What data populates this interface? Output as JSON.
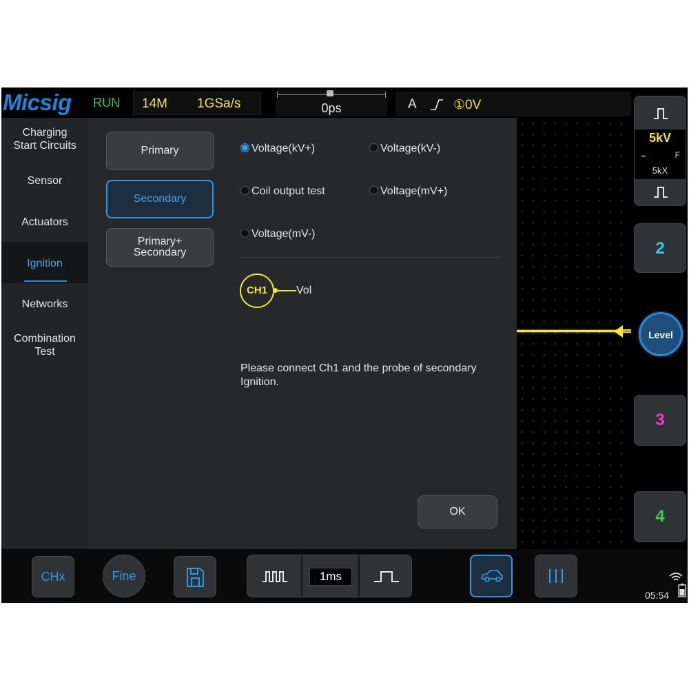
{
  "status_bar": {
    "brand": "Micsig",
    "run_state": "RUN",
    "memory_depth": "14M",
    "sample_rate": "1GSa/s",
    "horizontal_position": "0ps",
    "trigger_source": "A",
    "trigger_level": "①0V"
  },
  "left_nav": {
    "items": [
      {
        "label_line1": "Charging",
        "label_line2": "Start Circuits"
      },
      {
        "label_line1": "Sensor",
        "label_line2": ""
      },
      {
        "label_line1": "Actuators",
        "label_line2": ""
      },
      {
        "label_line1": "Ignition",
        "label_line2": ""
      },
      {
        "label_line1": "Networks",
        "label_line2": ""
      },
      {
        "label_line1": "Combination",
        "label_line2": "Test"
      }
    ],
    "active": "Ignition"
  },
  "coil_buttons": {
    "primary": "Primary",
    "secondary": "Secondary",
    "primary_secondary_line1": "Primary+",
    "primary_secondary_line2": "Secondary",
    "selected": "Secondary"
  },
  "test_options": {
    "voltage_kv_plus": "Voltage(kV+)",
    "voltage_kv_minus": "Voltage(kV-)",
    "coil_output_test": "Coil output test",
    "voltage_mv_plus": "Voltage(mV+)",
    "voltage_mv_minus": "Voltage(mV-)",
    "selected": "Voltage(kV+)"
  },
  "connection": {
    "channel": "CH1",
    "signal": "Vol",
    "message": "Please connect Ch1 and the probe of secondary Ignition."
  },
  "dialog": {
    "ok_label": "OK"
  },
  "right_panel": {
    "ch1_scale": "5kV",
    "ch1_coupling_flag": "F",
    "ch1_probe": "5kX",
    "ch2_label": "2",
    "level_label": "Level",
    "ch3_label": "3",
    "ch4_label": "4"
  },
  "bottom_bar": {
    "chx_label": "CHx",
    "fine_label": "Fine",
    "timebase": "1ms",
    "clock": "05:54"
  },
  "colors": {
    "ch1": "#f5e52c",
    "ch2": "#37c8f0",
    "ch3": "#e640c8",
    "ch4": "#3ad24a",
    "accent": "#2a8de0"
  }
}
